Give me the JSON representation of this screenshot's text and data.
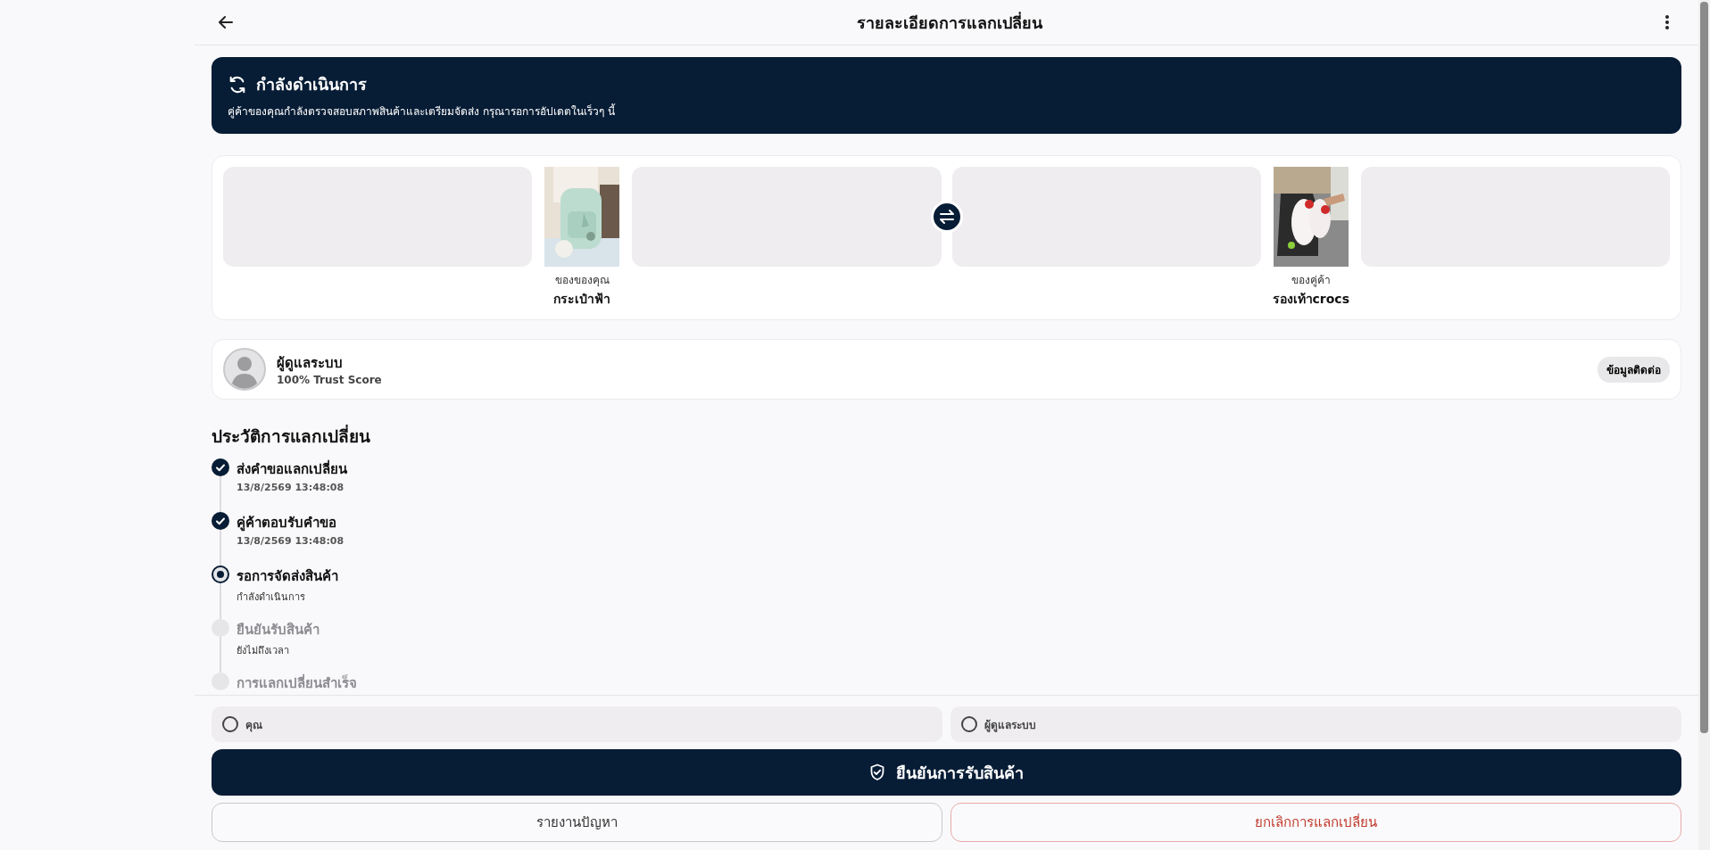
{
  "header": {
    "title": "รายละเอียดการแลกเปลี่ยน"
  },
  "status_banner": {
    "title": "กำลังดำเนินการ",
    "message": "คู่ค้าของคุณกำลังตรวจสอบสภาพสินค้าและเตรียมจัดส่ง กรุณารอการอัปเดตในเร็วๆ นี้"
  },
  "items": [
    {
      "owner": "ของของคุณ",
      "name": "กระเป๋าฟ้า",
      "kind": "picture"
    },
    {
      "owner": "ของคู่ค้า",
      "name": "รองเท้าcrocs",
      "kind": "picture"
    }
  ],
  "partner": {
    "name": "ผู้ดูแลระบบ",
    "trust": "100% Trust Score",
    "contact_button": "ข้อมูลติดต่อ"
  },
  "history": {
    "title": "ประวัติการแลกเปลี่ยน",
    "steps": [
      {
        "title": "ส่งคำขอแลกเปลี่ยน",
        "detail": "13/8/2569 13:48:08",
        "kind": "done"
      },
      {
        "title": "คู่ค้าตอบรับคำขอ",
        "detail": "13/8/2569 13:48:08",
        "kind": "done"
      },
      {
        "title": "รอการจัดส่งสินค้า",
        "detail": "กำลังดำเนินการ",
        "kind": "current"
      },
      {
        "title": "ยืนยันรับสินค้า",
        "detail": "ยังไม่ถึงเวลา",
        "kind": "pending"
      },
      {
        "title": "การแลกเปลี่ยนสำเร็จ",
        "kind": "pending"
      }
    ]
  },
  "confirmations": [
    {
      "label": "คุณ",
      "selected": false
    },
    {
      "label": "ผู้ดูแลระบบ",
      "selected": false
    }
  ],
  "buttons": {
    "confirm": "ยืนยันการรับสินค้า",
    "report": "รายงานปัญหา",
    "cancel": "ยกเลิกการแลกเปลี่ยน"
  }
}
